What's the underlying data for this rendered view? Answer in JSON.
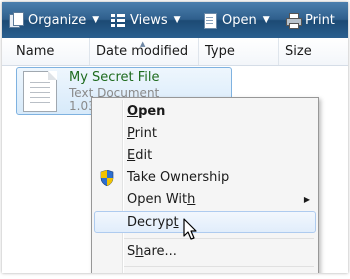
{
  "toolbar": {
    "organize_label": "Organize",
    "views_label": "Views",
    "open_label": "Open",
    "print_label": "Print",
    "dropdown_caret": "▼"
  },
  "columns": {
    "name": "Name",
    "date_modified": "Date modified",
    "type": "Type",
    "size": "Size"
  },
  "file": {
    "name": "My Secret File",
    "type": "Text Document",
    "size": "1.03"
  },
  "context_menu": {
    "items": [
      {
        "label": "Open",
        "mnemonic_index": 0
      },
      {
        "label": "Print",
        "mnemonic_index": 0
      },
      {
        "label": "Edit",
        "mnemonic_index": 0
      },
      {
        "label": "Take Ownership"
      },
      {
        "label": "Open With",
        "mnemonic_index": 8,
        "submenu_arrow": "▶"
      },
      {
        "label": "Decrypt",
        "mnemonic_index": 6
      },
      {
        "label": "Share...",
        "mnemonic_index": 1
      }
    ]
  },
  "colors": {
    "toolbar": "#2f5f8c",
    "selection_border": "#7fb2e0",
    "file_name": "#1e6b1e",
    "menu_highlight": "#e1edfb",
    "shield_blue": "#2e6fd0",
    "shield_yellow": "#f2c200"
  }
}
